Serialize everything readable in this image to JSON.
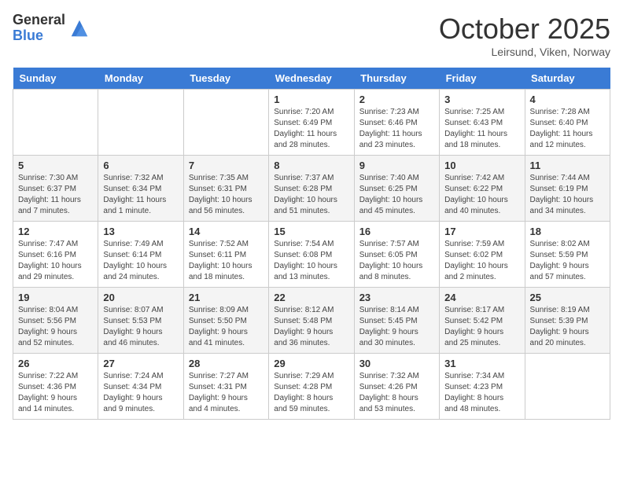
{
  "header": {
    "logo_general": "General",
    "logo_blue": "Blue",
    "month": "October 2025",
    "location": "Leirsund, Viken, Norway"
  },
  "days_of_week": [
    "Sunday",
    "Monday",
    "Tuesday",
    "Wednesday",
    "Thursday",
    "Friday",
    "Saturday"
  ],
  "weeks": [
    [
      {
        "num": "",
        "info": ""
      },
      {
        "num": "",
        "info": ""
      },
      {
        "num": "",
        "info": ""
      },
      {
        "num": "1",
        "info": "Sunrise: 7:20 AM\nSunset: 6:49 PM\nDaylight: 11 hours\nand 28 minutes."
      },
      {
        "num": "2",
        "info": "Sunrise: 7:23 AM\nSunset: 6:46 PM\nDaylight: 11 hours\nand 23 minutes."
      },
      {
        "num": "3",
        "info": "Sunrise: 7:25 AM\nSunset: 6:43 PM\nDaylight: 11 hours\nand 18 minutes."
      },
      {
        "num": "4",
        "info": "Sunrise: 7:28 AM\nSunset: 6:40 PM\nDaylight: 11 hours\nand 12 minutes."
      }
    ],
    [
      {
        "num": "5",
        "info": "Sunrise: 7:30 AM\nSunset: 6:37 PM\nDaylight: 11 hours\nand 7 minutes."
      },
      {
        "num": "6",
        "info": "Sunrise: 7:32 AM\nSunset: 6:34 PM\nDaylight: 11 hours\nand 1 minute."
      },
      {
        "num": "7",
        "info": "Sunrise: 7:35 AM\nSunset: 6:31 PM\nDaylight: 10 hours\nand 56 minutes."
      },
      {
        "num": "8",
        "info": "Sunrise: 7:37 AM\nSunset: 6:28 PM\nDaylight: 10 hours\nand 51 minutes."
      },
      {
        "num": "9",
        "info": "Sunrise: 7:40 AM\nSunset: 6:25 PM\nDaylight: 10 hours\nand 45 minutes."
      },
      {
        "num": "10",
        "info": "Sunrise: 7:42 AM\nSunset: 6:22 PM\nDaylight: 10 hours\nand 40 minutes."
      },
      {
        "num": "11",
        "info": "Sunrise: 7:44 AM\nSunset: 6:19 PM\nDaylight: 10 hours\nand 34 minutes."
      }
    ],
    [
      {
        "num": "12",
        "info": "Sunrise: 7:47 AM\nSunset: 6:16 PM\nDaylight: 10 hours\nand 29 minutes."
      },
      {
        "num": "13",
        "info": "Sunrise: 7:49 AM\nSunset: 6:14 PM\nDaylight: 10 hours\nand 24 minutes."
      },
      {
        "num": "14",
        "info": "Sunrise: 7:52 AM\nSunset: 6:11 PM\nDaylight: 10 hours\nand 18 minutes."
      },
      {
        "num": "15",
        "info": "Sunrise: 7:54 AM\nSunset: 6:08 PM\nDaylight: 10 hours\nand 13 minutes."
      },
      {
        "num": "16",
        "info": "Sunrise: 7:57 AM\nSunset: 6:05 PM\nDaylight: 10 hours\nand 8 minutes."
      },
      {
        "num": "17",
        "info": "Sunrise: 7:59 AM\nSunset: 6:02 PM\nDaylight: 10 hours\nand 2 minutes."
      },
      {
        "num": "18",
        "info": "Sunrise: 8:02 AM\nSunset: 5:59 PM\nDaylight: 9 hours\nand 57 minutes."
      }
    ],
    [
      {
        "num": "19",
        "info": "Sunrise: 8:04 AM\nSunset: 5:56 PM\nDaylight: 9 hours\nand 52 minutes."
      },
      {
        "num": "20",
        "info": "Sunrise: 8:07 AM\nSunset: 5:53 PM\nDaylight: 9 hours\nand 46 minutes."
      },
      {
        "num": "21",
        "info": "Sunrise: 8:09 AM\nSunset: 5:50 PM\nDaylight: 9 hours\nand 41 minutes."
      },
      {
        "num": "22",
        "info": "Sunrise: 8:12 AM\nSunset: 5:48 PM\nDaylight: 9 hours\nand 36 minutes."
      },
      {
        "num": "23",
        "info": "Sunrise: 8:14 AM\nSunset: 5:45 PM\nDaylight: 9 hours\nand 30 minutes."
      },
      {
        "num": "24",
        "info": "Sunrise: 8:17 AM\nSunset: 5:42 PM\nDaylight: 9 hours\nand 25 minutes."
      },
      {
        "num": "25",
        "info": "Sunrise: 8:19 AM\nSunset: 5:39 PM\nDaylight: 9 hours\nand 20 minutes."
      }
    ],
    [
      {
        "num": "26",
        "info": "Sunrise: 7:22 AM\nSunset: 4:36 PM\nDaylight: 9 hours\nand 14 minutes."
      },
      {
        "num": "27",
        "info": "Sunrise: 7:24 AM\nSunset: 4:34 PM\nDaylight: 9 hours\nand 9 minutes."
      },
      {
        "num": "28",
        "info": "Sunrise: 7:27 AM\nSunset: 4:31 PM\nDaylight: 9 hours\nand 4 minutes."
      },
      {
        "num": "29",
        "info": "Sunrise: 7:29 AM\nSunset: 4:28 PM\nDaylight: 8 hours\nand 59 minutes."
      },
      {
        "num": "30",
        "info": "Sunrise: 7:32 AM\nSunset: 4:26 PM\nDaylight: 8 hours\nand 53 minutes."
      },
      {
        "num": "31",
        "info": "Sunrise: 7:34 AM\nSunset: 4:23 PM\nDaylight: 8 hours\nand 48 minutes."
      },
      {
        "num": "",
        "info": ""
      }
    ]
  ]
}
